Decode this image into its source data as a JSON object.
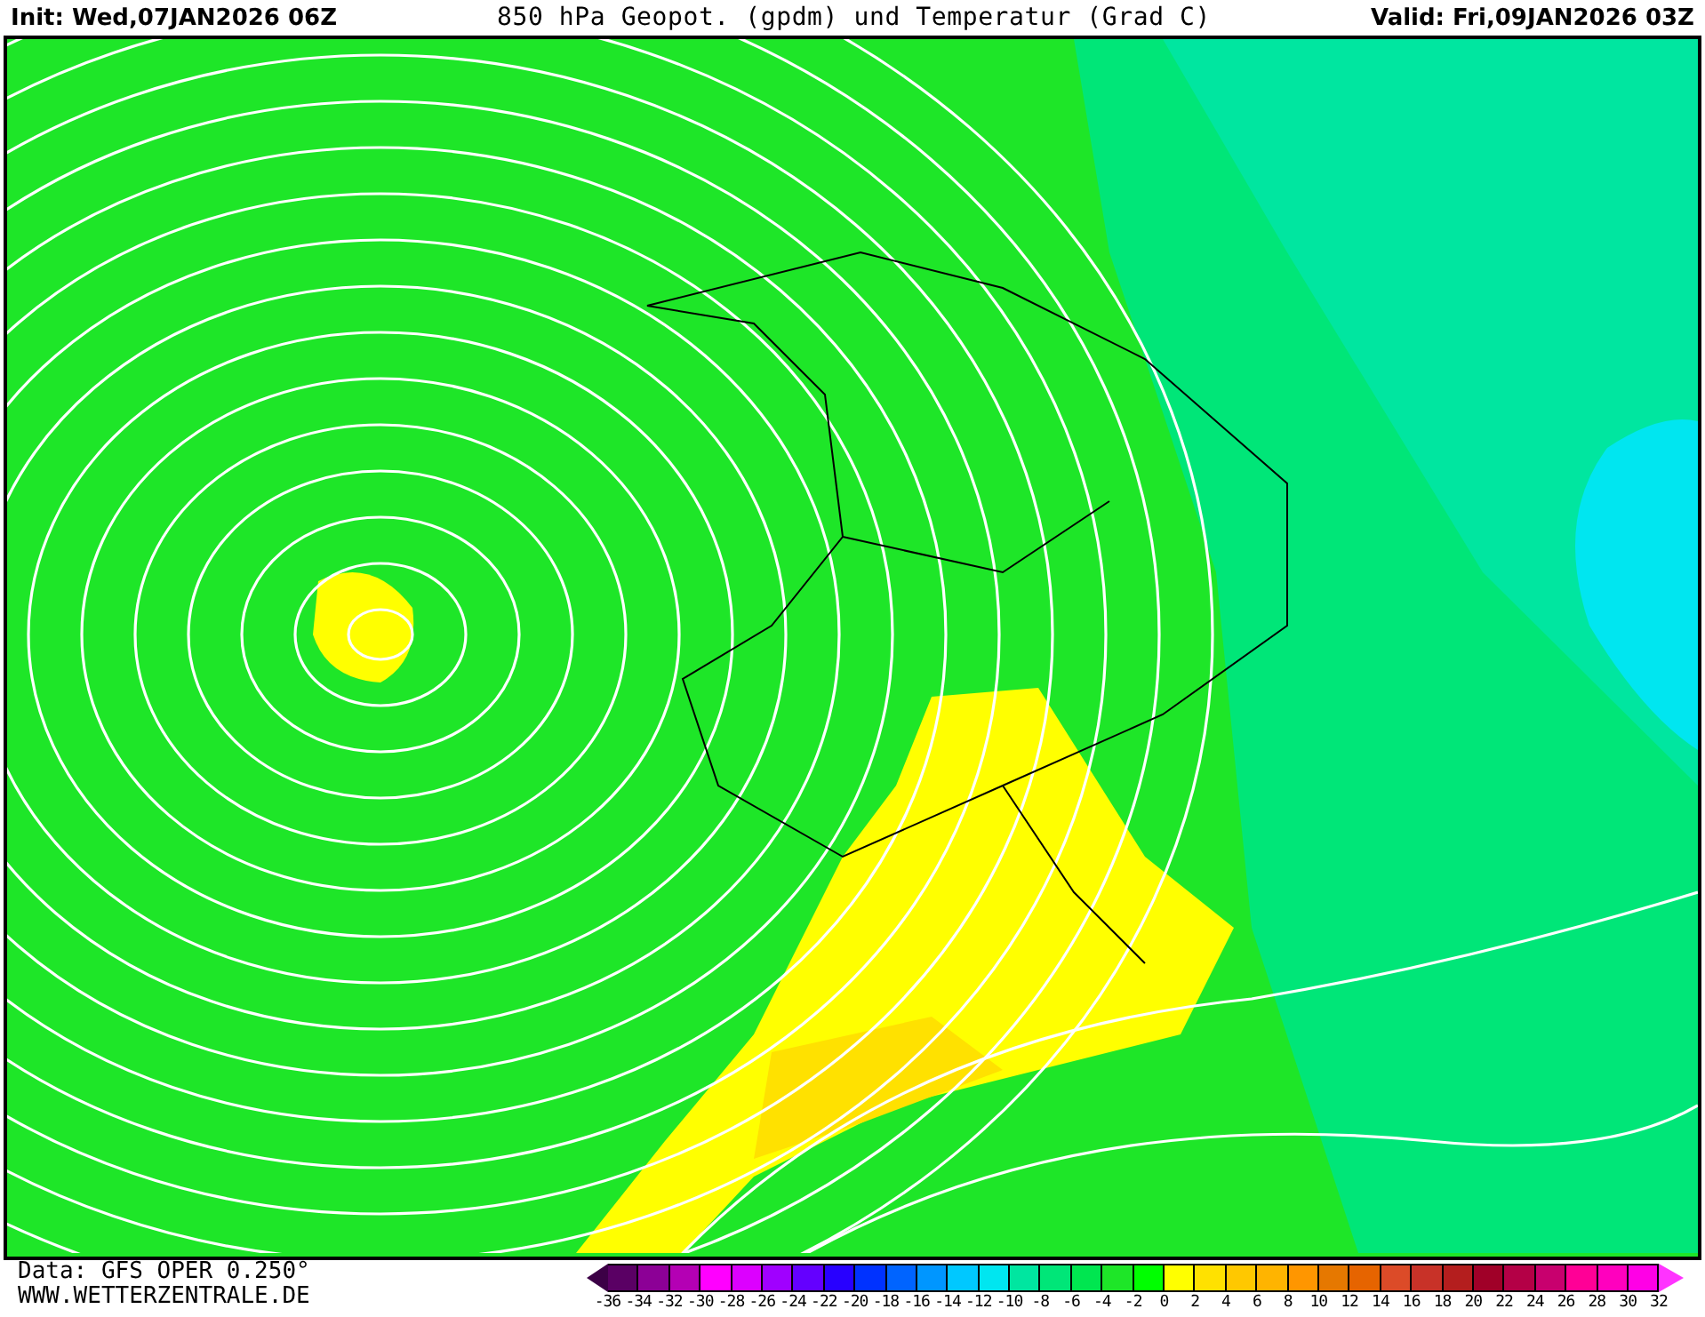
{
  "header": {
    "init": "Init: Wed,07JAN2026 06Z",
    "title": "850 hPa Geopot. (gpdm) und Temperatur (Grad C)",
    "valid": "Valid: Fri,09JAN2026 03Z"
  },
  "footer": {
    "data_source": "Data: GFS OPER 0.250°",
    "website": "WWW.WETTERZENTRALE.DE"
  },
  "legend": {
    "ends": [
      {
        "color": "#3c0046"
      },
      {
        "color": "#ff33ff"
      }
    ],
    "cells": [
      {
        "color": "#5a0064"
      },
      {
        "color": "#8c0096"
      },
      {
        "color": "#b400b4"
      },
      {
        "color": "#ff00ff"
      },
      {
        "color": "#dc00ff"
      },
      {
        "color": "#a000ff"
      },
      {
        "color": "#6400ff"
      },
      {
        "color": "#2800ff"
      },
      {
        "color": "#0032ff"
      },
      {
        "color": "#0064ff"
      },
      {
        "color": "#0096ff"
      },
      {
        "color": "#00c8ff"
      },
      {
        "color": "#00e6f0"
      },
      {
        "color": "#00e6a0"
      },
      {
        "color": "#00e678"
      },
      {
        "color": "#00e650"
      },
      {
        "color": "#1ee628"
      },
      {
        "color": "#00ff00"
      },
      {
        "color": "#ffff00"
      },
      {
        "color": "#ffe100"
      },
      {
        "color": "#ffc800"
      },
      {
        "color": "#ffb400"
      },
      {
        "color": "#ff9600"
      },
      {
        "color": "#e67800"
      },
      {
        "color": "#e66400"
      },
      {
        "color": "#dc4b28"
      },
      {
        "color": "#c83228"
      },
      {
        "color": "#b41e1e"
      },
      {
        "color": "#a00028"
      },
      {
        "color": "#b40046"
      },
      {
        "color": "#c8006e"
      },
      {
        "color": "#ff0096"
      },
      {
        "color": "#ff00be"
      },
      {
        "color": "#ff00e6"
      }
    ],
    "labels": [
      "-36",
      "-34",
      "-32",
      "-30",
      "-28",
      "-26",
      "-24",
      "-22",
      "-20",
      "-18",
      "-16",
      "-14",
      "-12",
      "-10",
      "-8",
      "-6",
      "-4",
      "-2",
      "0",
      "2",
      "4",
      "6",
      "8",
      "10",
      "12",
      "14",
      "16",
      "18",
      "20",
      "22",
      "24",
      "26",
      "28",
      "30",
      "32"
    ]
  }
}
